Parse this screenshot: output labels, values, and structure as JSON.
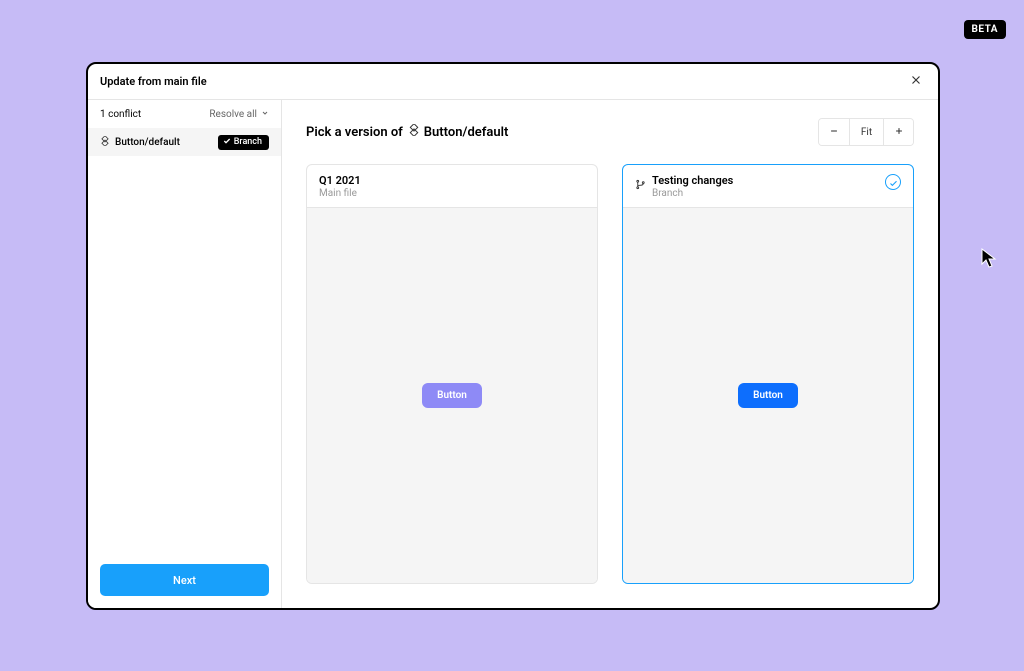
{
  "beta_label": "BETA",
  "modal": {
    "title": "Update from main file"
  },
  "sidebar": {
    "conflict_count": "1 conflict",
    "resolve_all_label": "Resolve all",
    "next_label": "Next",
    "item": {
      "name": "Button/default",
      "chip": "Branch"
    }
  },
  "main": {
    "pick_prefix": "Pick a version of",
    "component_name": "Button/default",
    "zoom_fit": "Fit"
  },
  "versions": {
    "left": {
      "title": "Q1 2021",
      "subtitle": "Main file",
      "button_label": "Button"
    },
    "right": {
      "title": "Testing changes",
      "subtitle": "Branch",
      "button_label": "Button"
    }
  }
}
